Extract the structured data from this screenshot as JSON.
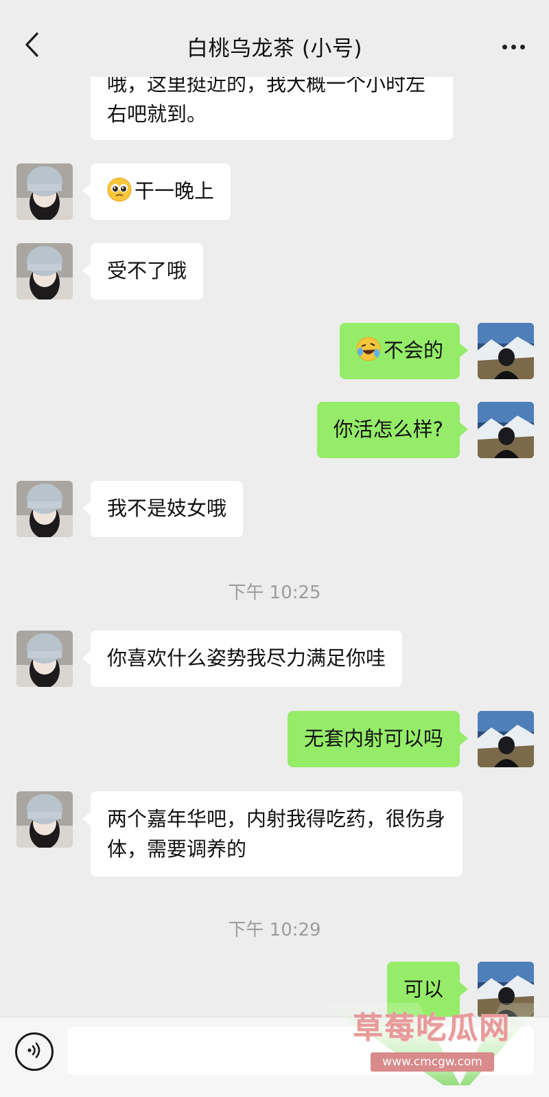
{
  "header": {
    "title": "白桃乌龙茶 (小号)"
  },
  "messages": [
    {
      "side": "in",
      "text": "哦，这里挺近的，我大概一个小时左右吧就到。"
    },
    {
      "side": "in",
      "text": "干一晚上",
      "emoji": "pleading-face"
    },
    {
      "side": "in",
      "text": "受不了哦"
    },
    {
      "side": "out",
      "text": "不会的",
      "emoji": "rolling-laughing-face"
    },
    {
      "side": "out",
      "text": "你活怎么样?"
    },
    {
      "side": "in",
      "text": "我不是妓女哦"
    },
    {
      "side": "in",
      "text": "你喜欢什么姿势我尽力满足你哇"
    },
    {
      "side": "out",
      "text": "无套内射可以吗"
    },
    {
      "side": "in",
      "text": "两个嘉年华吧，内射我得吃药，很伤身体，需要调养的"
    },
    {
      "side": "out",
      "text": "可以"
    }
  ],
  "timestamps": [
    "下午 10:25",
    "下午 10:29"
  ],
  "colors": {
    "background": "#ededed",
    "incoming_bubble": "#ffffff",
    "outgoing_bubble": "#95ec69",
    "timestamp_text": "#9c9c9c"
  },
  "icons": {
    "back": "chevron-left-icon",
    "more": "more-dots-icon",
    "voice": "voice-icon"
  },
  "watermark": {
    "title": "草莓吃瓜网",
    "url": "www.cmcgw.com"
  }
}
